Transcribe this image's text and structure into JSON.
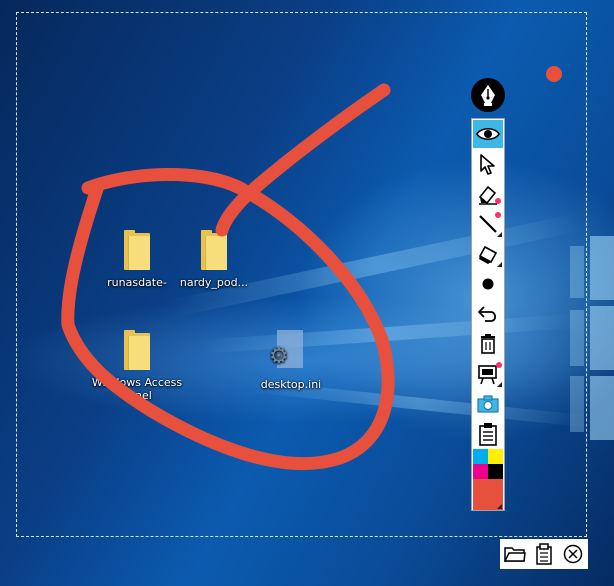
{
  "desktop": {
    "icons": [
      {
        "label": "runasdate-",
        "kind": "folder",
        "icon": "folder-icon"
      },
      {
        "label": "nardy_pod...",
        "kind": "folder",
        "icon": "folder-icon"
      },
      {
        "label": "Windows Access Panel",
        "kind": "folder",
        "icon": "folder-icon"
      },
      {
        "label": "desktop.ini",
        "kind": "settings-file",
        "icon": "settings-file-icon"
      }
    ]
  },
  "annotation": {
    "stroke_color": "#e8503e"
  },
  "toolbar": {
    "menu_icon": "pen-nib-icon",
    "tools": [
      {
        "icon": "eye-icon",
        "active": true
      },
      {
        "icon": "pointer-icon",
        "active": false
      },
      {
        "icon": "highlighter-icon",
        "active": false
      },
      {
        "icon": "line-icon",
        "active": false
      },
      {
        "icon": "eraser-icon",
        "active": false
      },
      {
        "icon": "pen-size-dot-icon",
        "active": false
      },
      {
        "icon": "undo-icon",
        "active": false
      },
      {
        "icon": "trash-icon",
        "active": false
      },
      {
        "icon": "whiteboard-icon",
        "active": false
      },
      {
        "icon": "camera-icon",
        "active": false
      },
      {
        "icon": "clipboard-icon",
        "active": false
      }
    ],
    "palette": [
      "#00aeef",
      "#ffef00",
      "#ec008c",
      "#000000"
    ],
    "current_color": "#e8503e",
    "accent_color": "#3fb6e6"
  },
  "bottom_bar": {
    "buttons": [
      {
        "icon": "folder-open-icon"
      },
      {
        "icon": "clipboard-icon"
      },
      {
        "icon": "close-circle-icon"
      }
    ]
  }
}
